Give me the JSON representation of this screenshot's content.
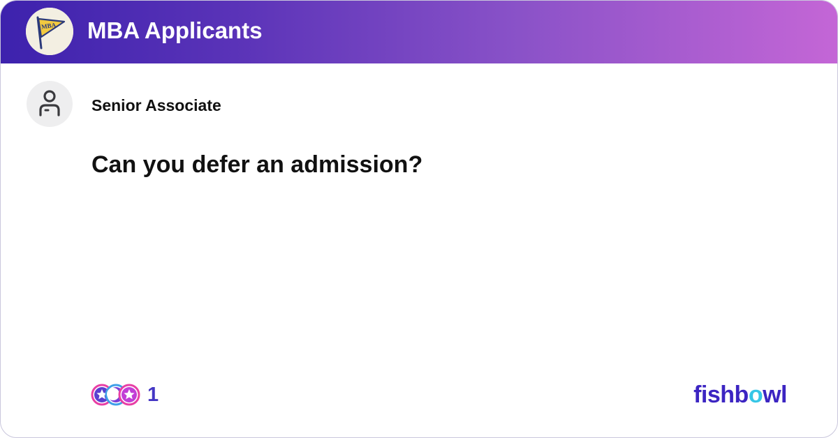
{
  "header": {
    "group_name": "MBA Applicants",
    "group_logo_text": "MBA",
    "gradient_start": "#3d22ad",
    "gradient_end": "#c466d6"
  },
  "post": {
    "author_title": "Senior Associate",
    "question": "Can you defer an admission?"
  },
  "footer": {
    "reaction_count": "1",
    "reaction_icons": [
      "star-badge-icon",
      "moon-badge-icon",
      "star-badge-icon"
    ],
    "brand_prefix": "fishb",
    "brand_accent": "o",
    "brand_suffix": "wl",
    "brand_color": "#3c25c2",
    "brand_accent_color": "#36c6e6"
  }
}
